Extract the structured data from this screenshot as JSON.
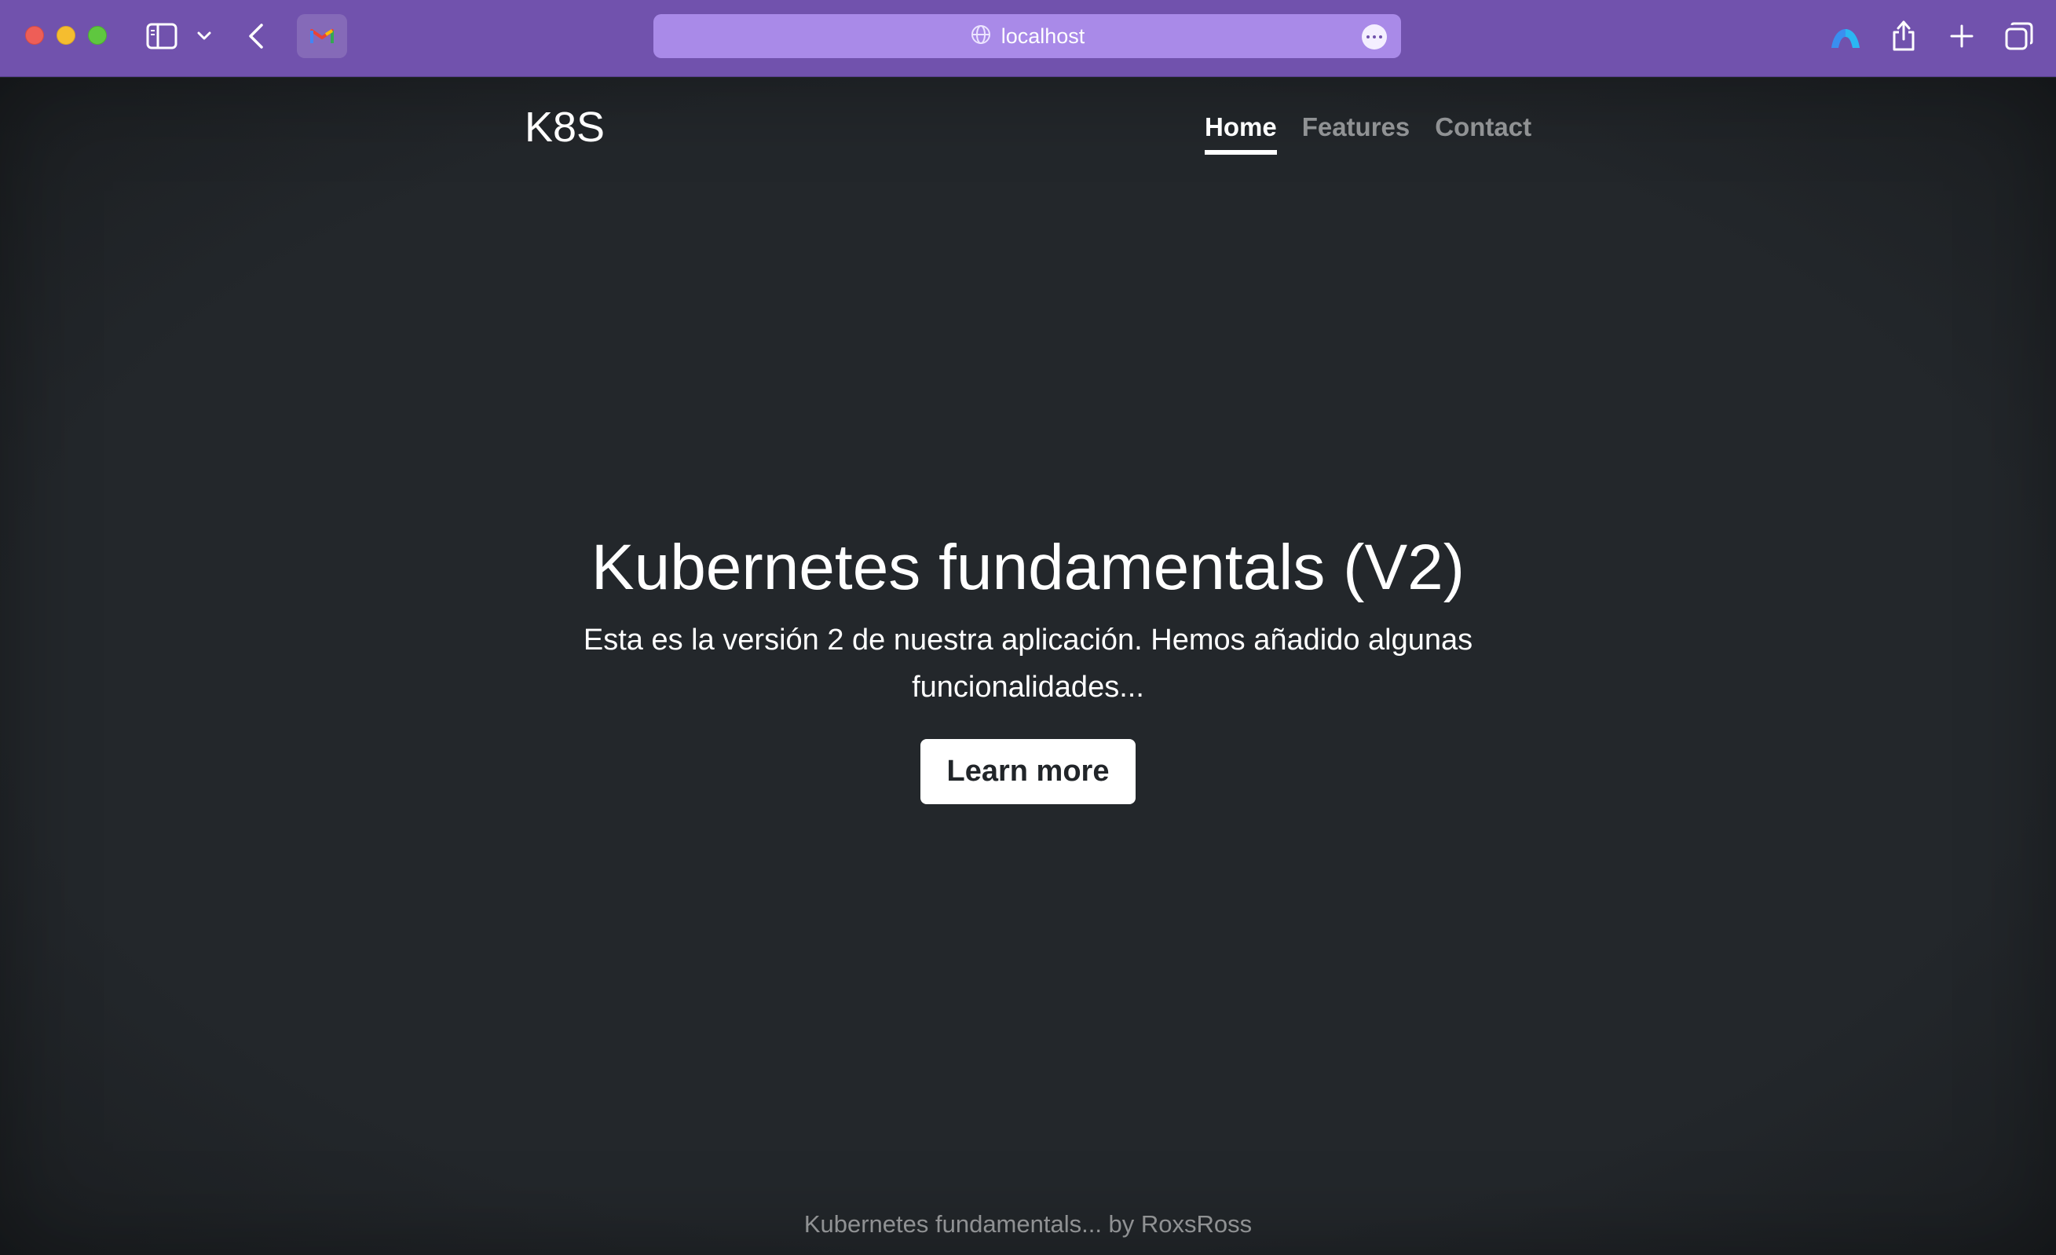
{
  "browser": {
    "url": "localhost",
    "accent_color": "#7152ad",
    "address_bar_color": "#a98ae8",
    "icons": {
      "sidebar": "sidebar-icon",
      "chevron": "chevron-down-icon",
      "back": "back-arrow-icon",
      "favicon": "gmail-icon",
      "globe": "globe-icon",
      "more": "more-dots-icon",
      "extension": "extension-icon",
      "share": "share-icon",
      "new_tab": "plus-icon",
      "tab_overview": "tabs-overview-icon"
    }
  },
  "site": {
    "brand": "K8S",
    "nav": [
      {
        "label": "Home",
        "active": true
      },
      {
        "label": "Features",
        "active": false
      },
      {
        "label": "Contact",
        "active": false
      }
    ],
    "hero": {
      "title": "Kubernetes fundamentals (V2)",
      "subtitle": "Esta es la versión 2 de nuestra aplicación. Hemos añadido algunas funcionalidades...",
      "button": "Learn more"
    },
    "footer": "Kubernetes fundamentals... by RoxsRoss",
    "background_color": "#212529"
  }
}
